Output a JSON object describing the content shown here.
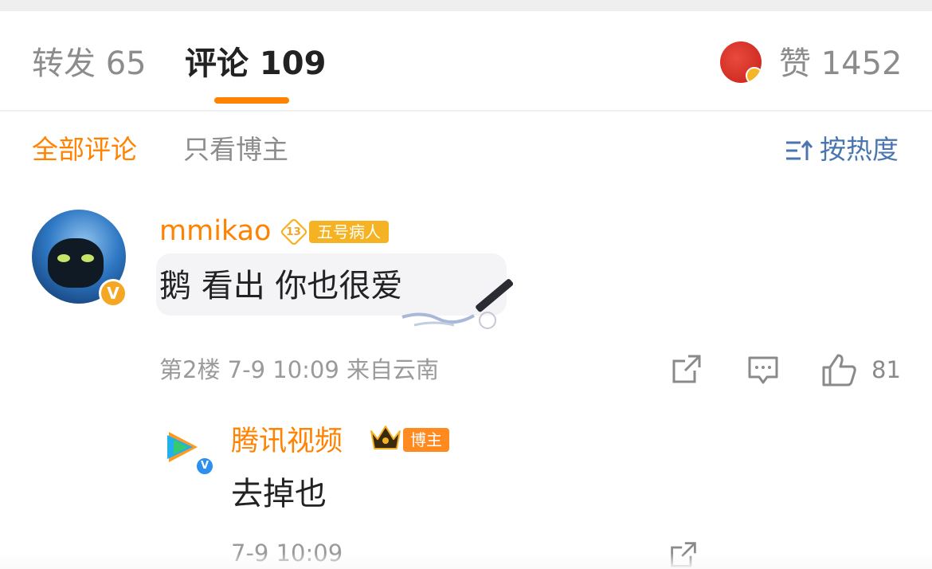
{
  "tabs": {
    "repost": "转发 65",
    "comments": "评论 109",
    "likes": "赞 1452"
  },
  "filters": {
    "all": "全部评论",
    "blogger_only": "只看博主",
    "sort": "按热度"
  },
  "comment": {
    "username": "mmikao",
    "level": "13",
    "title_badge": "五号病人",
    "text": "鹅 看出 你也很爱",
    "meta": "第2楼  7-9 10:09  来自云南",
    "like_count": "81"
  },
  "reply": {
    "username": "腾讯视频",
    "badge": "博主",
    "text": "去掉也",
    "meta": "7-9 10:09"
  },
  "colors": {
    "accent": "#ff8200",
    "link_blue": "#4a76b0",
    "verified_gold": "#f5a623",
    "verified_blue": "#2d8ff0"
  }
}
